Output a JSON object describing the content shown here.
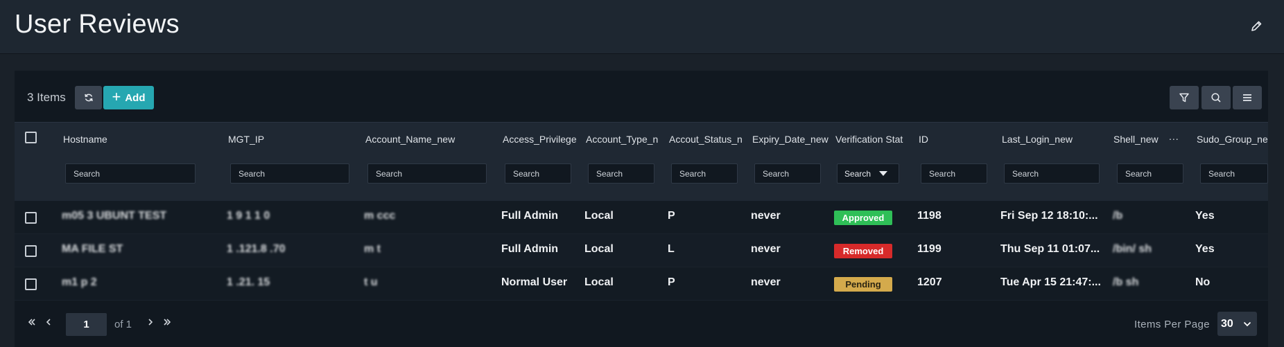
{
  "header": {
    "title": "User Reviews"
  },
  "toolbar": {
    "items_count": "3 Items",
    "add_label": "Add"
  },
  "columns": [
    {
      "label": "Hostname"
    },
    {
      "label": "MGT_IP"
    },
    {
      "label": "Account_Name_new"
    },
    {
      "label": "Access_Privilege"
    },
    {
      "label": "Account_Type_n"
    },
    {
      "label": "Accout_Status_n"
    },
    {
      "label": "Expiry_Date_new"
    },
    {
      "label": "Verification Stat"
    },
    {
      "label": "ID"
    },
    {
      "label": "Last_Login_new"
    },
    {
      "label": "Shell_new"
    },
    {
      "label": "Sudo_Group_ne"
    }
  ],
  "search_placeholder": "Search",
  "rows": [
    {
      "hostname": "m05 3  UBUNT  TEST",
      "mgt_ip": "1  9  1 1  0",
      "account_name": "m  ccc",
      "access_privilege": "Full Admin",
      "account_type": "Local",
      "account_status": "P",
      "expiry_date": "never",
      "verification_status": "Approved",
      "id": "1198",
      "last_login": "Fri Sep 12 18:10:...",
      "shell": "/b      ",
      "sudo_group": "Yes"
    },
    {
      "hostname": "MA      FILE  ST",
      "mgt_ip": "1  .121.8  .70",
      "account_name": "m          t",
      "access_privilege": "Full Admin",
      "account_type": "Local",
      "account_status": "L",
      "expiry_date": "never",
      "verification_status": "Removed",
      "id": "1199",
      "last_login": "Thu Sep 11 01:07...",
      "shell": "/bin/  sh",
      "sudo_group": "Yes"
    },
    {
      "hostname": "m1        p   2",
      "mgt_ip": "1  .21.   15",
      "account_name": "t  u",
      "access_privilege": "Normal User",
      "account_type": "Local",
      "account_status": "P",
      "expiry_date": "never",
      "verification_status": "Pending",
      "id": "1207",
      "last_login": "Tue Apr 15 21:47:...",
      "shell": "/b    sh",
      "sudo_group": "No"
    }
  ],
  "pager": {
    "page": "1",
    "of_total": "of 1",
    "items_per_page_label": "Items Per Page",
    "items_per_page": "30"
  },
  "icons": {
    "edit": "pencil-icon",
    "refresh": "refresh-icon",
    "filter": "filter-icon",
    "search": "search-icon",
    "menu": "menu-icon",
    "first": "double-chevron-left-icon",
    "prev": "chevron-left-icon",
    "next": "chevron-right-icon",
    "last": "double-chevron-right-icon",
    "dropdown": "chevron-down-icon"
  },
  "colors": {
    "accent": "#26a7b1",
    "approved": "#2fbf57",
    "removed": "#d72a2a",
    "pending": "#d4aa4c",
    "background": "#1a2129"
  }
}
